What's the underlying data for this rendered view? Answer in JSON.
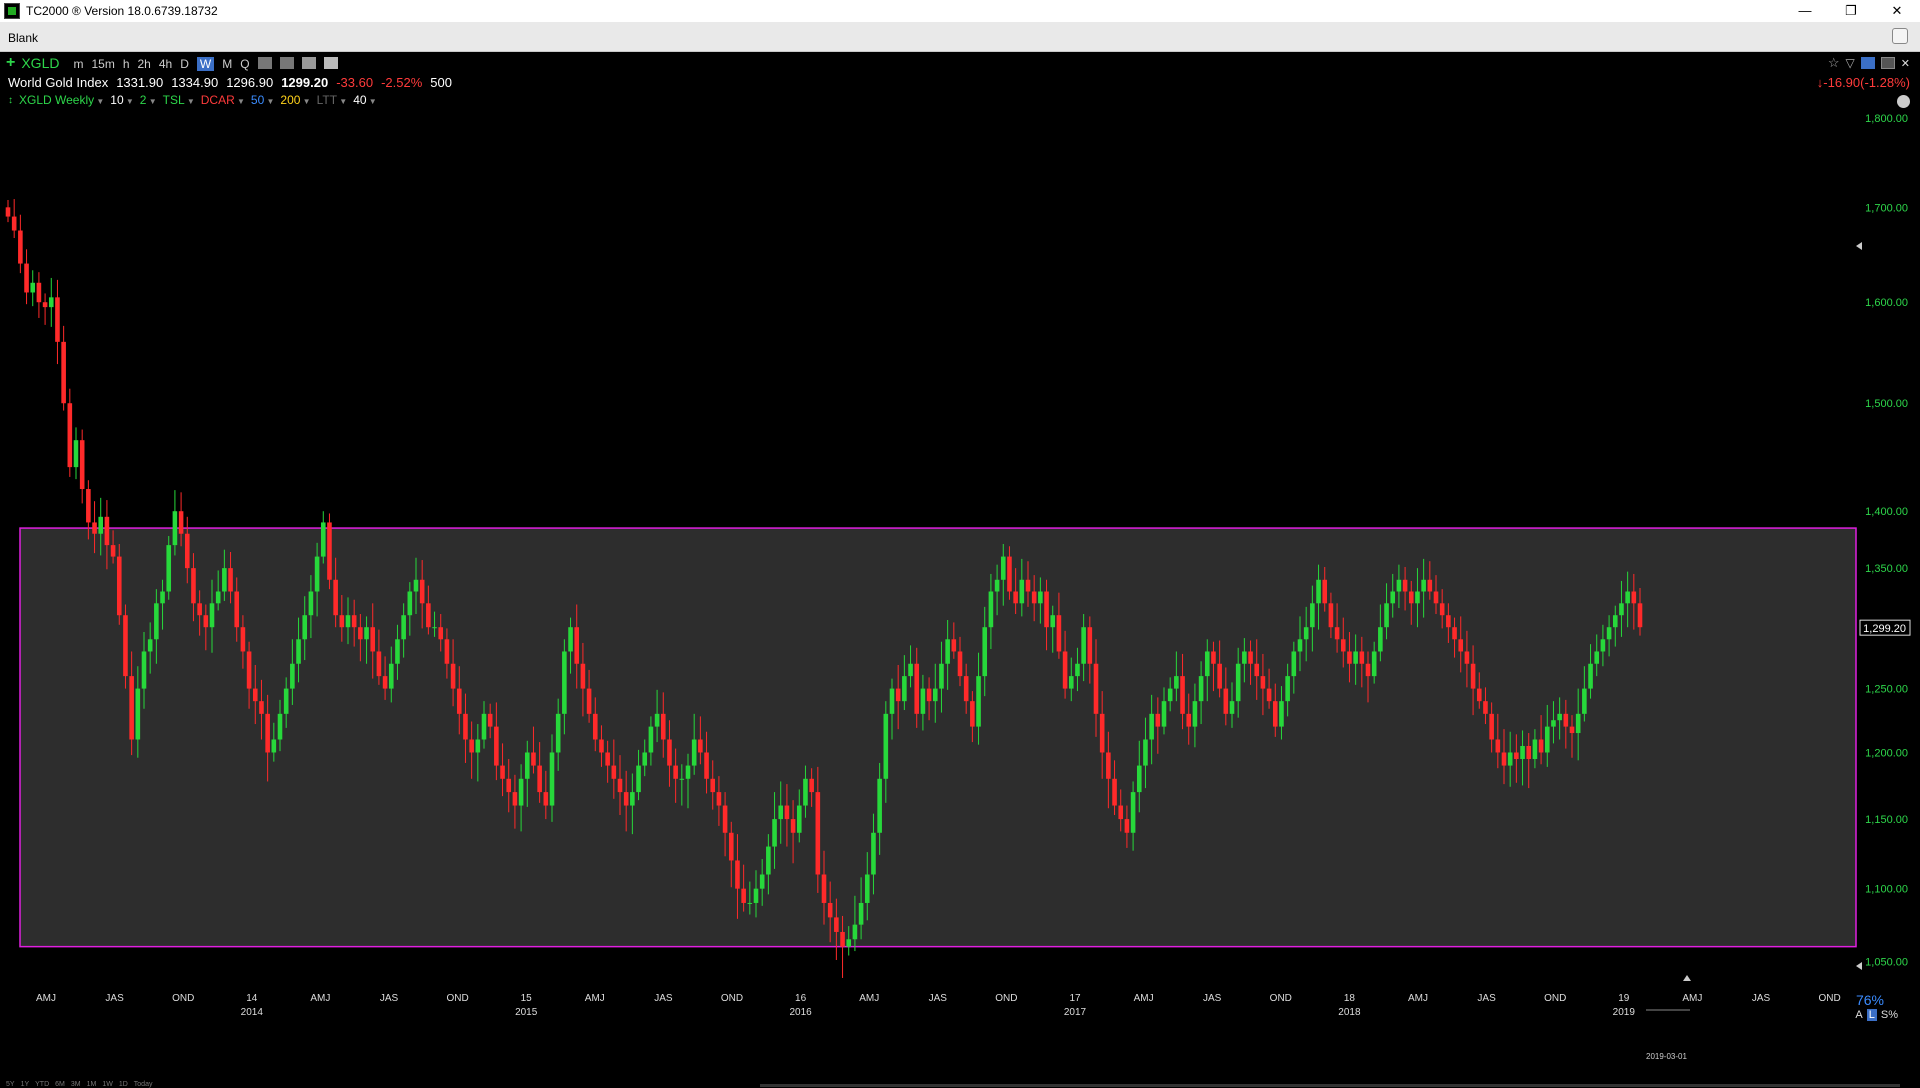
{
  "window": {
    "title": "TC2000 ® Version 18.0.6739.18732",
    "tab": "Blank"
  },
  "toolbar": {
    "symbol": "XGLD",
    "timeframes": [
      "m",
      "15m",
      "h",
      "2h",
      "4h",
      "D",
      "W",
      "M",
      "Q"
    ],
    "active_timeframe": "W"
  },
  "quote": {
    "name": "World Gold Index",
    "open": "1331.90",
    "high": "1334.90",
    "low": "1296.90",
    "last": "1299.20",
    "change": "-33.60",
    "change_pct": "-2.52%",
    "bars": "500",
    "right_change": "-16.90(-1.28%)"
  },
  "indicators": [
    {
      "label": "XGLD Weekly",
      "color": "#2dd64a"
    },
    {
      "label": "10",
      "color": "#ffffff"
    },
    {
      "label": "2",
      "color": "#2dd64a"
    },
    {
      "label": "TSL",
      "color": "#2dd64a"
    },
    {
      "label": "DCAR",
      "color": "#ff3b3b"
    },
    {
      "label": "50",
      "color": "#3b8cff"
    },
    {
      "label": "200",
      "color": "#ffd21a"
    },
    {
      "label": "LTT",
      "color": "#666666"
    },
    {
      "label": "40",
      "color": "#ffffff"
    }
  ],
  "chart_data": {
    "type": "candlestick",
    "symbol": "XGLD",
    "ylim": [
      1035,
      1830
    ],
    "y_ticks": [
      "1,800.00",
      "1,700.00",
      "1,600.00",
      "1,500.00",
      "1,400.00",
      "1,350.00",
      "1,300.00",
      "1,250.00",
      "1,200.00",
      "1,150.00",
      "1,100.00",
      "1,050.00"
    ],
    "last_price_label": "1,299.20",
    "x_labels": [
      {
        "label": "AMJ",
        "year": ""
      },
      {
        "label": "JAS",
        "year": ""
      },
      {
        "label": "OND",
        "year": ""
      },
      {
        "label": "14",
        "year": "2014"
      },
      {
        "label": "AMJ",
        "year": ""
      },
      {
        "label": "JAS",
        "year": ""
      },
      {
        "label": "OND",
        "year": ""
      },
      {
        "label": "15",
        "year": "2015"
      },
      {
        "label": "AMJ",
        "year": ""
      },
      {
        "label": "JAS",
        "year": ""
      },
      {
        "label": "OND",
        "year": ""
      },
      {
        "label": "16",
        "year": "2016"
      },
      {
        "label": "AMJ",
        "year": ""
      },
      {
        "label": "JAS",
        "year": ""
      },
      {
        "label": "OND",
        "year": ""
      },
      {
        "label": "17",
        "year": "2017"
      },
      {
        "label": "AMJ",
        "year": ""
      },
      {
        "label": "JAS",
        "year": ""
      },
      {
        "label": "OND",
        "year": ""
      },
      {
        "label": "18",
        "year": "2018"
      },
      {
        "label": "AMJ",
        "year": ""
      },
      {
        "label": "JAS",
        "year": ""
      },
      {
        "label": "OND",
        "year": ""
      },
      {
        "label": "19",
        "year": "2019"
      },
      {
        "label": "AMJ",
        "year": ""
      },
      {
        "label": "JAS",
        "year": ""
      },
      {
        "label": "OND",
        "year": ""
      }
    ],
    "range_box": {
      "top": 1385,
      "bottom": 1060,
      "color": "#e020e0"
    },
    "series_close": [
      1690,
      1675,
      1640,
      1610,
      1620,
      1600,
      1595,
      1605,
      1560,
      1500,
      1440,
      1465,
      1420,
      1390,
      1380,
      1395,
      1370,
      1360,
      1310,
      1260,
      1210,
      1250,
      1280,
      1290,
      1320,
      1330,
      1370,
      1400,
      1380,
      1350,
      1320,
      1310,
      1300,
      1320,
      1330,
      1350,
      1330,
      1300,
      1280,
      1250,
      1240,
      1230,
      1200,
      1210,
      1230,
      1250,
      1270,
      1290,
      1310,
      1330,
      1360,
      1390,
      1340,
      1310,
      1300,
      1310,
      1300,
      1290,
      1300,
      1280,
      1260,
      1250,
      1270,
      1290,
      1310,
      1330,
      1340,
      1320,
      1300,
      1300,
      1290,
      1270,
      1250,
      1230,
      1210,
      1200,
      1210,
      1230,
      1220,
      1190,
      1180,
      1170,
      1160,
      1180,
      1200,
      1190,
      1170,
      1160,
      1200,
      1230,
      1280,
      1300,
      1270,
      1250,
      1230,
      1210,
      1200,
      1190,
      1180,
      1170,
      1160,
      1170,
      1190,
      1200,
      1220,
      1230,
      1210,
      1190,
      1180,
      1180,
      1190,
      1210,
      1200,
      1180,
      1170,
      1160,
      1140,
      1120,
      1100,
      1090,
      1090,
      1100,
      1110,
      1130,
      1150,
      1160,
      1150,
      1140,
      1160,
      1180,
      1170,
      1110,
      1090,
      1080,
      1070,
      1060,
      1065,
      1075,
      1090,
      1110,
      1140,
      1180,
      1230,
      1250,
      1240,
      1260,
      1270,
      1230,
      1250,
      1240,
      1250,
      1270,
      1290,
      1280,
      1260,
      1240,
      1220,
      1260,
      1300,
      1330,
      1340,
      1360,
      1330,
      1320,
      1340,
      1330,
      1320,
      1330,
      1300,
      1310,
      1280,
      1250,
      1260,
      1270,
      1300,
      1270,
      1230,
      1200,
      1180,
      1160,
      1150,
      1140,
      1170,
      1190,
      1210,
      1230,
      1220,
      1240,
      1250,
      1260,
      1230,
      1220,
      1240,
      1260,
      1280,
      1270,
      1250,
      1230,
      1240,
      1270,
      1280,
      1270,
      1260,
      1250,
      1240,
      1220,
      1240,
      1260,
      1280,
      1290,
      1300,
      1320,
      1340,
      1320,
      1300,
      1290,
      1280,
      1270,
      1280,
      1270,
      1260,
      1280,
      1300,
      1320,
      1330,
      1340,
      1330,
      1320,
      1330,
      1340,
      1330,
      1320,
      1310,
      1300,
      1290,
      1280,
      1270,
      1250,
      1240,
      1230,
      1210,
      1200,
      1190,
      1200,
      1195,
      1205,
      1195,
      1210,
      1200,
      1220,
      1225,
      1230,
      1220,
      1215,
      1230,
      1250,
      1270,
      1280,
      1290,
      1300,
      1310,
      1320,
      1330,
      1320,
      1300
    ]
  },
  "zoom": "76%",
  "axis_mode": [
    "A",
    "L",
    "S%"
  ],
  "current_date": "2019-03-01",
  "bottom_ranges": [
    "5Y",
    "1Y",
    "YTD",
    "6M",
    "3M",
    "1M",
    "1W",
    "1D",
    "Today"
  ]
}
